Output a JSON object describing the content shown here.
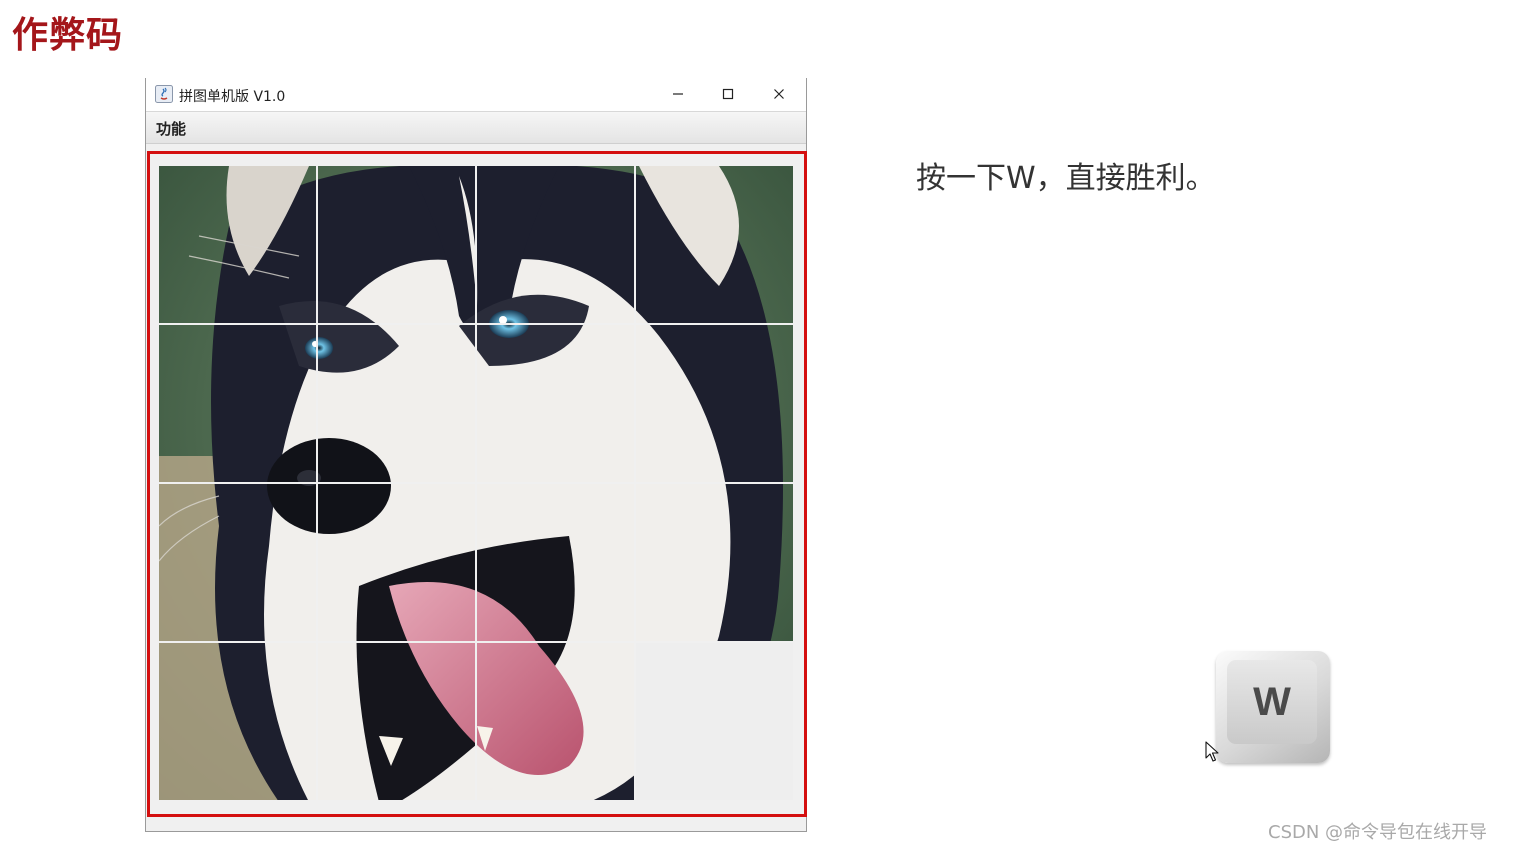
{
  "slide": {
    "title": "作弊码",
    "instruction": "按一下W，直接胜利。",
    "watermark": "CSDN @命令导包在线开导"
  },
  "window": {
    "title": "拼图单机版 V1.0",
    "controls": {
      "minimize_icon": "minimize-icon",
      "maximize_icon": "maximize-icon",
      "close_icon": "close-icon"
    },
    "menu": [
      "功能"
    ]
  },
  "puzzle": {
    "grid": "4x4",
    "filled_tiles": 15,
    "empty_position": "bottom-right",
    "image": "husky-dog-photo"
  },
  "key": {
    "label": "W"
  },
  "colors": {
    "title_red": "#a4161a",
    "highlight_red": "#d40f0f"
  }
}
